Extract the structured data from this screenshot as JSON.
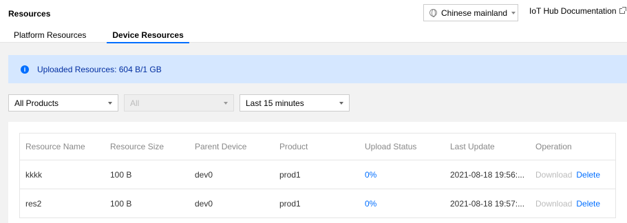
{
  "header": {
    "title": "Resources",
    "region": "Chinese mainland",
    "doc_link": "IoT Hub Documentation"
  },
  "tabs": [
    {
      "label": "Platform Resources",
      "active": false
    },
    {
      "label": "Device Resources",
      "active": true
    }
  ],
  "alert": {
    "text": "Uploaded Resources: 604 B/1 GB"
  },
  "filters": {
    "product": "All Products",
    "device": "All",
    "time_range": "Last 15 minutes"
  },
  "table": {
    "columns": [
      "Resource Name",
      "Resource Size",
      "Parent Device",
      "Product",
      "Upload Status",
      "Last Update",
      "Operation"
    ],
    "rows": [
      {
        "name": "kkkk",
        "size": "100 B",
        "device": "dev0",
        "product": "prod1",
        "status": "0%",
        "updated": "2021-08-18 19:56:...",
        "download": "Download",
        "delete": "Delete"
      },
      {
        "name": "res2",
        "size": "100 B",
        "device": "dev0",
        "product": "prod1",
        "status": "0%",
        "updated": "2021-08-18 19:57:...",
        "download": "Download",
        "delete": "Delete"
      }
    ]
  },
  "colors": {
    "accent": "#006eff",
    "alert_bg": "#d5e7ff"
  }
}
